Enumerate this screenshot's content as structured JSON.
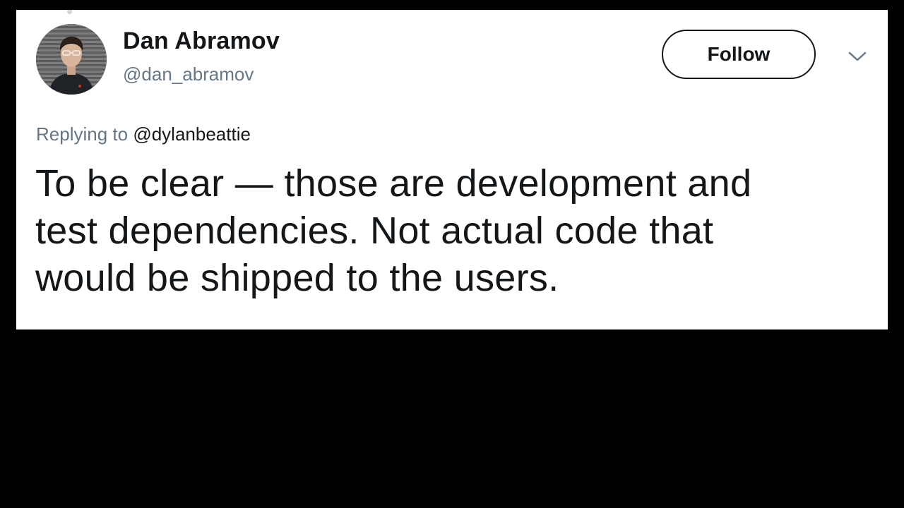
{
  "author": {
    "display_name": "Dan Abramov",
    "handle": "@dan_abramov"
  },
  "follow_button": {
    "label": "Follow"
  },
  "icons": {
    "menu": "chevron-down-icon"
  },
  "reply": {
    "prefix": "Replying to",
    "target": "@dylanbeattie"
  },
  "tweet": {
    "lines": [
      "To be clear — those are development and",
      "test dependencies. Not actual code that",
      "would be shipped to the users."
    ]
  },
  "colors": {
    "text_primary": "#14171a",
    "text_secondary": "#657786",
    "card_background": "#ffffff",
    "page_background": "#000000"
  }
}
